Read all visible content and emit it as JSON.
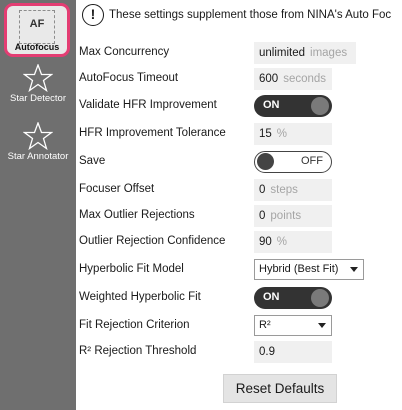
{
  "sidebar": {
    "items": [
      {
        "label": "Autofocus",
        "icon_text": "AF",
        "icon": "af-icon",
        "selected": true
      },
      {
        "label": "Star Detector",
        "icon": "star-icon",
        "selected": false
      },
      {
        "label": "Star Annotator",
        "icon": "star-icon",
        "selected": false
      }
    ],
    "background": "#6f6f6f",
    "selected_border": "#e43d73"
  },
  "header": {
    "icon": "info-icon",
    "icon_glyph": "!",
    "text": "These settings supplement those from NINA's Auto Foc"
  },
  "settings": {
    "max_concurrency": {
      "label": "Max Concurrency",
      "value": "unlimited",
      "unit": "images"
    },
    "autofocus_timeout": {
      "label": "AutoFocus Timeout",
      "value": "600",
      "unit": "seconds"
    },
    "validate_hfr": {
      "label": "Validate HFR Improvement",
      "state": "ON"
    },
    "hfr_tolerance": {
      "label": "HFR Improvement Tolerance",
      "value": "15",
      "unit": "%"
    },
    "save": {
      "label": "Save",
      "state": "OFF"
    },
    "focuser_offset": {
      "label": "Focuser Offset",
      "value": "0",
      "unit": "steps"
    },
    "max_outlier_rejections": {
      "label": "Max Outlier Rejections",
      "value": "0",
      "unit": "points"
    },
    "outlier_confidence": {
      "label": "Outlier Rejection Confidence",
      "value": "90",
      "unit": "%"
    },
    "hyperbolic_model": {
      "label": "Hyperbolic Fit Model",
      "selected": "Hybrid (Best Fit)"
    },
    "weighted_hyperbolic": {
      "label": "Weighted Hyperbolic Fit",
      "state": "ON"
    },
    "fit_rejection": {
      "label": "Fit Rejection Criterion",
      "selected": "R²"
    },
    "r2_threshold": {
      "label": "R² Rejection Threshold",
      "value": "0.9"
    }
  },
  "reset_label": "Reset Defaults"
}
